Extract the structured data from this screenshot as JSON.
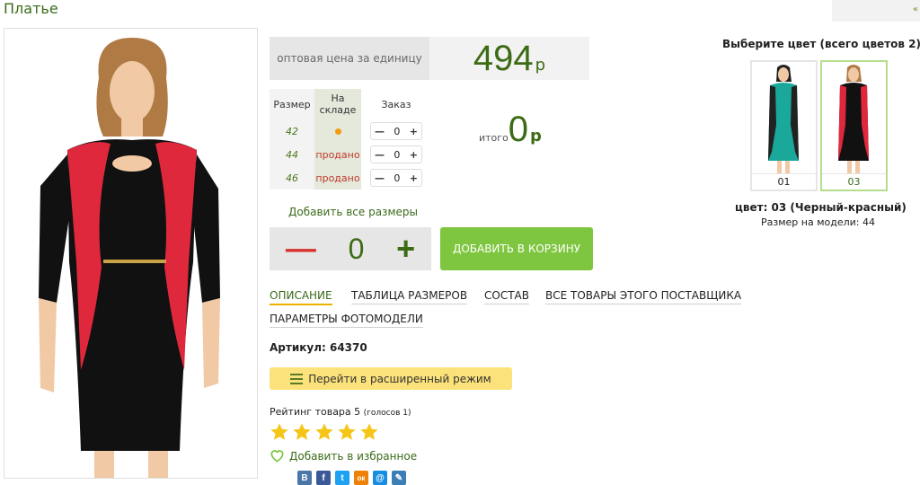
{
  "page": {
    "title": "Платье",
    "top_right_glyph": "«"
  },
  "price": {
    "label": "оптовая цена за единицу",
    "value": "494",
    "currency": "р"
  },
  "size_table": {
    "headers": [
      "Размер",
      "На складе",
      "Заказ"
    ],
    "rows": [
      {
        "size": "42",
        "stock": "",
        "in_stock": true,
        "qty": "0"
      },
      {
        "size": "44",
        "stock": "продано",
        "in_stock": false,
        "qty": "0"
      },
      {
        "size": "46",
        "stock": "продано",
        "in_stock": false,
        "qty": "0"
      }
    ],
    "minus": "—",
    "plus": "+"
  },
  "total": {
    "label": "итого",
    "value": "0",
    "currency": "р"
  },
  "add_all_sizes": "Добавить все размеры",
  "big_stepper": {
    "minus": "—",
    "value": "0",
    "plus": "+"
  },
  "cart_button": "ДОБАВИТЬ В КОРЗИНУ",
  "tabs": [
    {
      "label": "ОПИСАНИЕ",
      "active": true
    },
    {
      "label": "ТАБЛИЦА РАЗМЕРОВ",
      "active": false
    },
    {
      "label": "СОСТАВ",
      "active": false
    },
    {
      "label": "ВСЕ ТОВАРЫ ЭТОГО ПОСТАВЩИКА",
      "active": false
    },
    {
      "label": "ПАРАМЕТРЫ ФОТОМОДЕЛИ",
      "active": false
    }
  ],
  "article": "Артикул: 64370",
  "extended_mode": "Перейти в расширенный режим",
  "rating": {
    "text": "Рейтинг товара 5",
    "votes": "(голосов 1)",
    "stars": 5,
    "max": 5
  },
  "favorite": "Добавить в избранное",
  "social": [
    {
      "name": "vk-icon",
      "glyph": "В",
      "color": "#4a76a8"
    },
    {
      "name": "facebook-icon",
      "glyph": "f",
      "color": "#3b5998"
    },
    {
      "name": "twitter-icon",
      "glyph": "t",
      "color": "#1da1f2"
    },
    {
      "name": "odnoklassniki-icon",
      "glyph": "ок",
      "color": "#ee8208"
    },
    {
      "name": "mailru-icon",
      "glyph": "@",
      "color": "#168de2"
    },
    {
      "name": "livejournal-icon",
      "glyph": "✎",
      "color": "#3b7fb6"
    }
  ],
  "colors": {
    "title": "Выберите цвет (всего цветов 2)",
    "swatches": [
      {
        "code": "01",
        "selected": false,
        "main": "#1aa89a",
        "side": "#222"
      },
      {
        "code": "03",
        "selected": true,
        "main": "#e0283c",
        "side": "#111"
      }
    ],
    "selected_label": "цвет: 03 (Черный-красный)",
    "model_size": "Размер на модели: 44"
  }
}
